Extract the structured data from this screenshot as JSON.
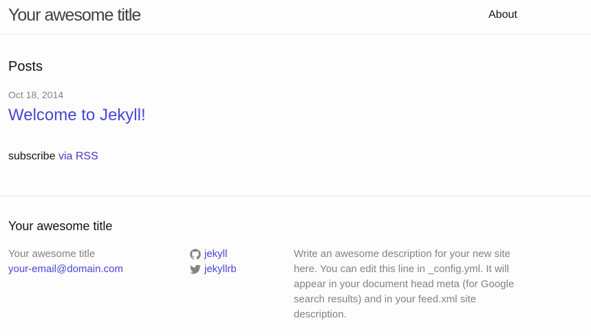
{
  "header": {
    "site_title": "Your awesome title",
    "nav": [
      "About"
    ]
  },
  "main": {
    "heading": "Posts",
    "posts": [
      {
        "date": "Oct 18, 2014",
        "title": "Welcome to Jekyll!"
      }
    ],
    "subscribe_text": "subscribe",
    "subscribe_link": "via RSS"
  },
  "footer": {
    "heading": "Your awesome title",
    "site_name": "Your awesome title",
    "email": "your-email@domain.com",
    "social": [
      {
        "icon": "github-icon",
        "label": "jekyll"
      },
      {
        "icon": "twitter-icon",
        "label": "jekyllrb"
      }
    ],
    "description": "Write an awesome description for your new site here. You can edit this line in _config.yml. It will appear in your document head meta (for Google search results) and in your feed.xml site description."
  },
  "colors": {
    "link": "#4a44d6",
    "text": "#111111",
    "muted": "#828282",
    "border": "#e8e8e8"
  }
}
